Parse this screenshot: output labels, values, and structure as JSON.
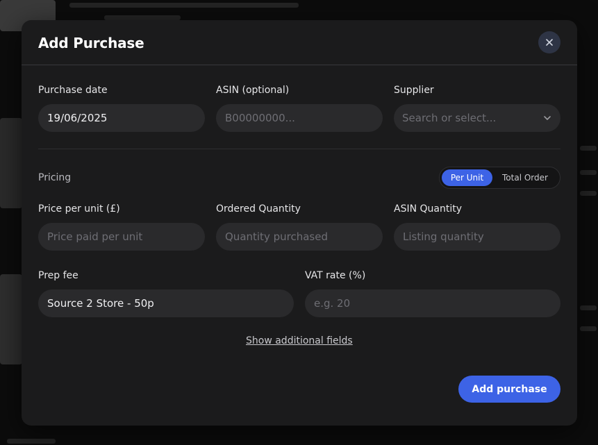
{
  "modal": {
    "title": "Add Purchase",
    "close_icon": "close-icon"
  },
  "fields": {
    "purchase_date": {
      "label": "Purchase date",
      "value": "19/06/2025"
    },
    "asin": {
      "label": "ASIN (optional)",
      "placeholder": "B00000000..."
    },
    "supplier": {
      "label": "Supplier",
      "placeholder": "Search or select...",
      "icon": "chevron-down-icon"
    },
    "price_per_unit": {
      "label": "Price per unit (£)",
      "placeholder": "Price paid per unit"
    },
    "ordered_quantity": {
      "label": "Ordered Quantity",
      "placeholder": "Quantity purchased"
    },
    "asin_quantity": {
      "label": "ASIN Quantity",
      "placeholder": "Listing quantity"
    },
    "prep_fee": {
      "label": "Prep fee",
      "value": "Source 2 Store - 50p"
    },
    "vat_rate": {
      "label": "VAT rate (%)",
      "placeholder": "e.g. 20"
    }
  },
  "pricing": {
    "label": "Pricing",
    "toggle": {
      "options": [
        "Per Unit",
        "Total Order"
      ],
      "selected": "Per Unit"
    }
  },
  "links": {
    "additional_fields": "Show additional fields"
  },
  "actions": {
    "submit_label": "Add purchase"
  },
  "colors": {
    "accent": "#3d63e6",
    "modal_bg": "#1b1b1c",
    "input_bg": "#2a2a2c"
  }
}
